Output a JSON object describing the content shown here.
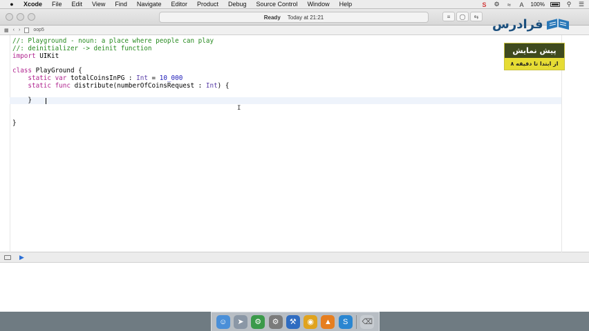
{
  "menubar": {
    "app_name": "Xcode",
    "items": [
      "File",
      "Edit",
      "View",
      "Find",
      "Navigate",
      "Editor",
      "Product",
      "Debug",
      "Source Control",
      "Window",
      "Help"
    ],
    "battery": "100%"
  },
  "window": {
    "status": "Ready",
    "status_time": "Today at 21:21",
    "breadcrumb_file": "oop5"
  },
  "editor": {
    "line1": "//: Playground - noun: a place where people can play",
    "line2": "//: deinitializer -> deinit function",
    "line3_kw": "import",
    "line3_rest": " UIKit",
    "line5_kw": "class",
    "line5_rest": " PlayGround {",
    "line6_indent": "    ",
    "line6_kw": "static var",
    "line6_name": " totalCoinsInPG : ",
    "line6_type": "Int",
    "line6_eq": " = ",
    "line6_num": "10_000",
    "line7_indent": "    ",
    "line7_kw": "static func",
    "line7_name": " distribute(numberOfCoinsRequest : ",
    "line7_type": "Int",
    "line7_end": ") {",
    "line9": "    }",
    "line12": "}"
  },
  "overlay": {
    "logo_text": "فرادرس",
    "promo_title": "پیش نمایش",
    "promo_subtitle": "از ابتدا تا دقیقه ۸"
  },
  "colors": {
    "comment": "#268a1f",
    "keyword": "#b0248f",
    "type": "#5a3ea8",
    "number": "#1c1ab8"
  }
}
